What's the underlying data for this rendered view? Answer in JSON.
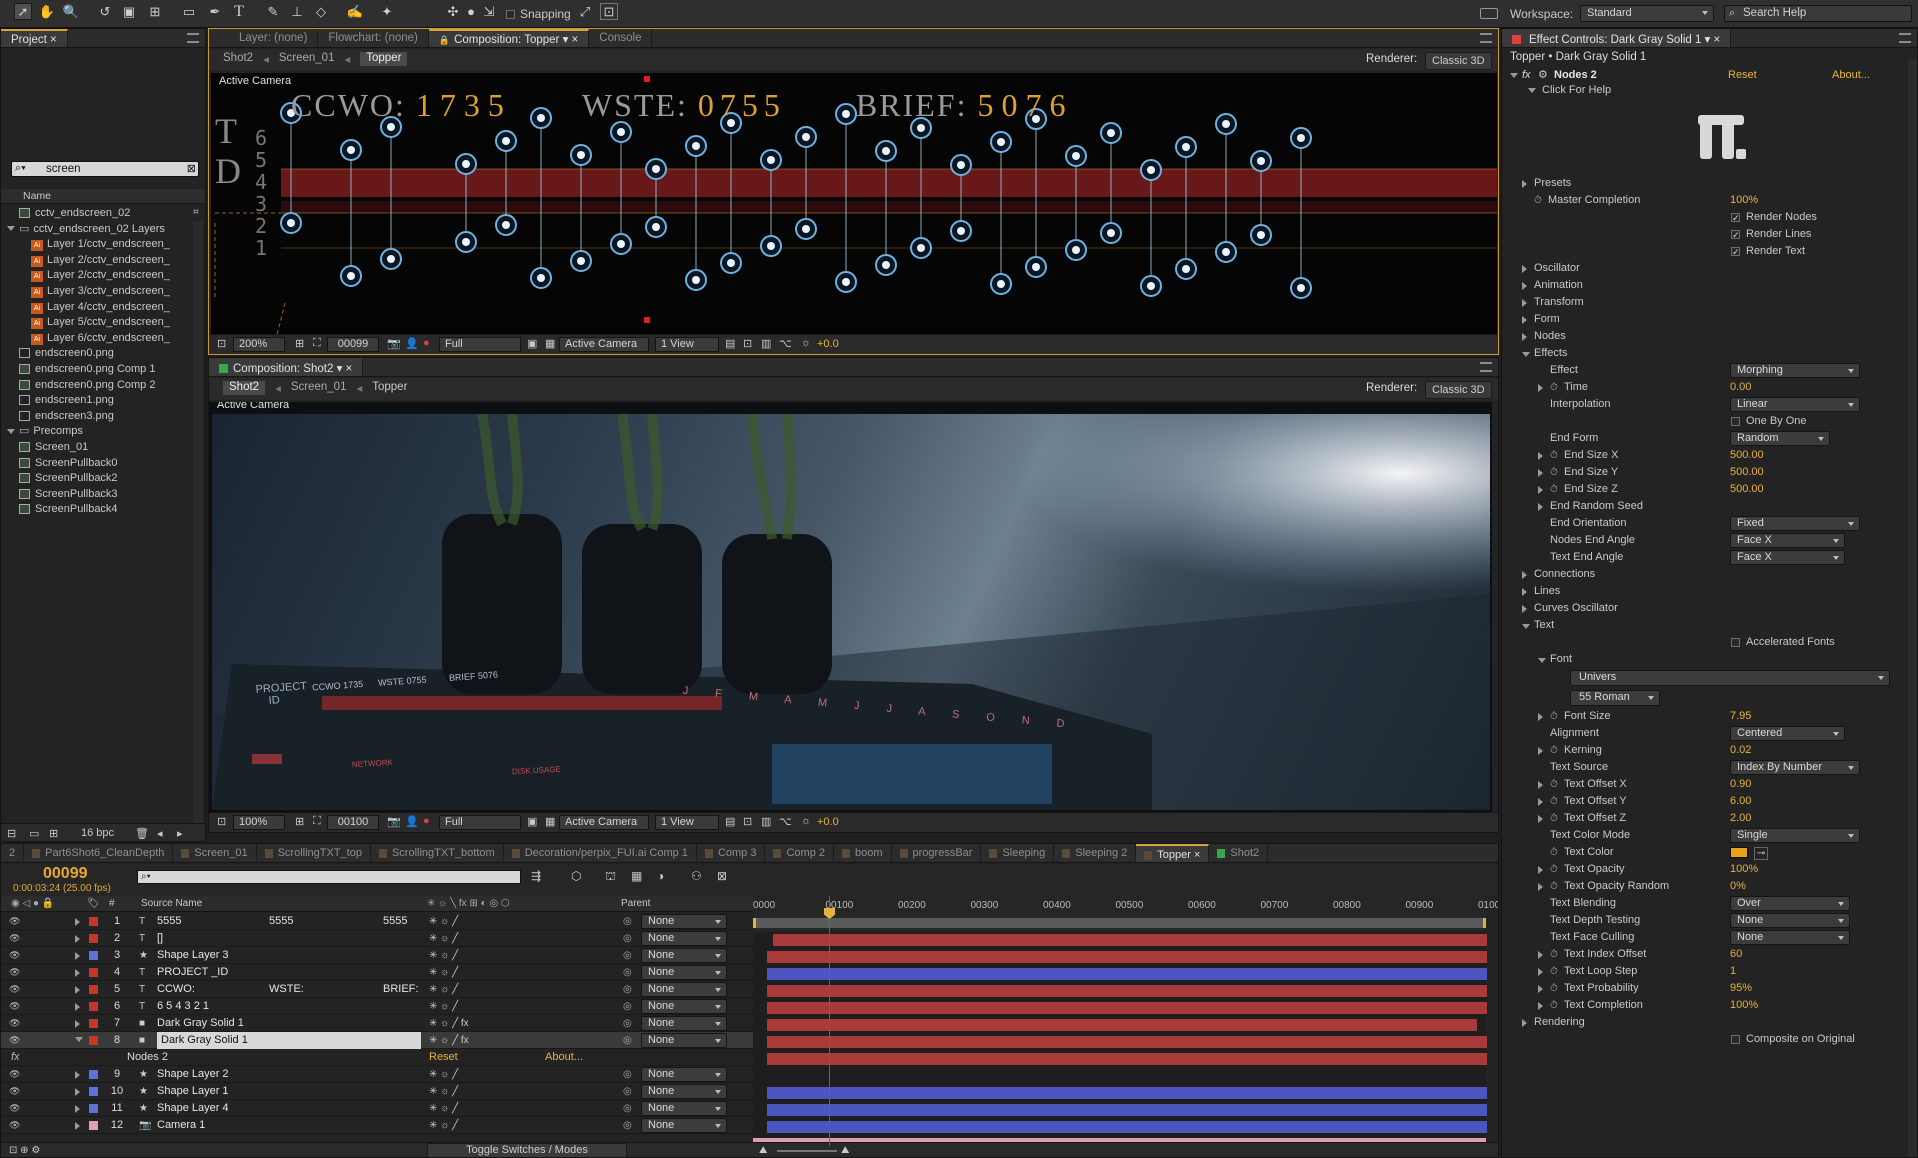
{
  "toolbar": {
    "snapping_label": "Snapping",
    "workspace_label": "Workspace:",
    "workspace_value": "Standard",
    "search_help_placeholder": "Search Help"
  },
  "project_panel": {
    "tab": "Project",
    "search_value": "screen",
    "column_name": "Name",
    "items": [
      {
        "label": "cctv_endscreen_02",
        "type": "comp",
        "indent": 0
      },
      {
        "label": "cctv_endscreen_02 Layers",
        "type": "folder",
        "indent": 0,
        "open": true
      },
      {
        "label": "Layer 1/cctv_endscreen_",
        "type": "ai",
        "indent": 1
      },
      {
        "label": "Layer 2/cctv_endscreen_",
        "type": "ai",
        "indent": 1
      },
      {
        "label": "Layer 2/cctv_endscreen_",
        "type": "ai",
        "indent": 1
      },
      {
        "label": "Layer 3/cctv_endscreen_",
        "type": "ai",
        "indent": 1
      },
      {
        "label": "Layer 4/cctv_endscreen_",
        "type": "ai",
        "indent": 1
      },
      {
        "label": "Layer 5/cctv_endscreen_",
        "type": "ai",
        "indent": 1
      },
      {
        "label": "Layer 6/cctv_endscreen_",
        "type": "ai",
        "indent": 1
      },
      {
        "label": "endscreen0.png",
        "type": "img",
        "indent": 0
      },
      {
        "label": "endscreen0.png Comp 1",
        "type": "comp",
        "indent": 0
      },
      {
        "label": "endscreen0.png Comp 2",
        "type": "comp",
        "indent": 0
      },
      {
        "label": "endscreen1.png",
        "type": "img",
        "indent": 0
      },
      {
        "label": "endscreen3.png",
        "type": "img",
        "indent": 0
      },
      {
        "label": "Precomps",
        "type": "folder",
        "indent": 0,
        "open": true
      },
      {
        "label": "Screen_01",
        "type": "comp",
        "indent": 1
      },
      {
        "label": "ScreenPullback0",
        "type": "comp",
        "indent": 0
      },
      {
        "label": "ScreenPullback2",
        "type": "comp",
        "indent": 0
      },
      {
        "label": "ScreenPullback3",
        "type": "comp",
        "indent": 0
      },
      {
        "label": "ScreenPullback4",
        "type": "comp",
        "indent": 0
      }
    ],
    "bpc": "16 bpc"
  },
  "viewer_top": {
    "tabs": [
      "Layer: (none)",
      "Flowchart: (none)",
      "Composition: Topper",
      "Console"
    ],
    "breadcrumbs": [
      "Shot2",
      "Screen_01",
      "Topper"
    ],
    "renderer_label": "Renderer:",
    "renderer_value": "Classic 3D",
    "camera_label": "Active Camera",
    "hud": {
      "ccwo_label": "CCWO:",
      "ccwo_value": "1735",
      "wste_label": "WSTE:",
      "wste_value": "0755",
      "brief_label": "BRIEF:",
      "brief_value": "5076"
    },
    "zoom": "200%",
    "frame": "00099",
    "resolution": "Full",
    "view_camera": "Active Camera",
    "views": "1 View",
    "exposure": "+0.0"
  },
  "viewer_bottom": {
    "tab": "Composition: Shot2",
    "breadcrumbs": [
      "Shot2",
      "Screen_01",
      "Topper"
    ],
    "renderer_label": "Renderer:",
    "renderer_value": "Classic 3D",
    "camera_label": "Active Camera",
    "zoom": "100%",
    "frame": "00100",
    "resolution": "Full",
    "view_camera": "Active Camera",
    "views": "1 View",
    "exposure": "+0.0",
    "scene_text": {
      "project": "PROJECT",
      "id": "ID",
      "ccwo": "CCWO 1735",
      "wste": "WSTE 0755",
      "brief": "BRIEF 5076",
      "network": "NETWORK",
      "disk": "DISK USAGE",
      "months": "J F M A M J J A S O N D"
    }
  },
  "timeline": {
    "tabs": [
      "2",
      "Part6Shot6_CleanDepth",
      "Screen_01",
      "ScrollingTXT_top",
      "ScrollingTXT_bottom",
      "Decoration/perpix_FUI.ai Comp 1",
      "Comp 3",
      "Comp 2",
      "boom",
      "progressBar",
      "Sleeping",
      "Sleeping 2",
      "Topper",
      "Shot2"
    ],
    "active_tab": "Topper",
    "timecode": "00099",
    "timecode_sub": "0:00:03:24 (25.00 fps)",
    "col_source": "Source Name",
    "col_parent": "Parent",
    "ruler": [
      "0000",
      "00100",
      "00200",
      "00300",
      "00400",
      "00500",
      "00600",
      "00700",
      "00800",
      "00900",
      "0100"
    ],
    "layers": [
      {
        "num": "1",
        "name": "5555",
        "extra1": "5555",
        "extra2": "5555",
        "type": "T",
        "color": "#c0392b",
        "parent": "None",
        "bar": "red"
      },
      {
        "num": "2",
        "name": "[]",
        "type": "T",
        "color": "#c0392b",
        "parent": "None",
        "bar": "red"
      },
      {
        "num": "3",
        "name": "Shape Layer 3",
        "type": "★",
        "color": "#5b72d6",
        "parent": "None",
        "bar": "blue"
      },
      {
        "num": "4",
        "name": "PROJECT _ID",
        "type": "T",
        "color": "#c0392b",
        "parent": "None",
        "bar": "red"
      },
      {
        "num": "5",
        "name": "CCWO:",
        "extra1": "WSTE:",
        "extra2": "BRIEF:",
        "type": "T",
        "color": "#c0392b",
        "parent": "None",
        "bar": "red"
      },
      {
        "num": "6",
        "name": "6 5 4 3 2 1",
        "type": "T",
        "color": "#c0392b",
        "parent": "None",
        "bar": "red"
      },
      {
        "num": "7",
        "name": "Dark Gray Solid 1",
        "type": "■",
        "color": "#c0392b",
        "parent": "None",
        "bar": "red",
        "fx": true
      },
      {
        "num": "8",
        "name": "Dark Gray Solid 1",
        "type": "■",
        "color": "#c0392b",
        "parent": "None",
        "bar": "red",
        "fx": true,
        "selected": true
      },
      {
        "num": "9",
        "name": "Shape Layer 2",
        "type": "★",
        "color": "#5b72d6",
        "parent": "None",
        "bar": "blue"
      },
      {
        "num": "10",
        "name": "Shape Layer 1",
        "type": "★",
        "color": "#5b72d6",
        "parent": "None",
        "bar": "blue"
      },
      {
        "num": "11",
        "name": "Shape Layer 4",
        "type": "★",
        "color": "#5b72d6",
        "parent": "None",
        "bar": "blue"
      },
      {
        "num": "12",
        "name": "Camera 1",
        "type": "📷",
        "color": "#e0a0b0",
        "parent": "None",
        "bar": "pink"
      }
    ],
    "fx_row": {
      "name": "Nodes 2",
      "reset": "Reset",
      "about": "About..."
    },
    "toggle_label": "Toggle Switches / Modes"
  },
  "effect_controls": {
    "tab": "Effect Controls: Dark Gray Solid 1",
    "subtitle": "Topper • Dark Gray Solid 1",
    "effect_name": "Nodes 2",
    "reset": "Reset",
    "about": "About...",
    "click_help": "Click For Help",
    "rows": [
      {
        "t": "group",
        "label": "Presets",
        "indent": 1
      },
      {
        "t": "val",
        "label": "Master Completion",
        "value": "100%",
        "indent": 1,
        "stop": true
      },
      {
        "t": "check",
        "label": "Render Nodes",
        "checked": true
      },
      {
        "t": "check",
        "label": "Render Lines",
        "checked": true
      },
      {
        "t": "check",
        "label": "Render Text",
        "checked": true
      },
      {
        "t": "gap"
      },
      {
        "t": "group",
        "label": "Oscillator",
        "indent": 1
      },
      {
        "t": "group",
        "label": "Animation",
        "indent": 1
      },
      {
        "t": "group",
        "label": "Transform",
        "indent": 1
      },
      {
        "t": "group",
        "label": "Form",
        "indent": 1
      },
      {
        "t": "group",
        "label": "Nodes",
        "indent": 1
      },
      {
        "t": "groupopen",
        "label": "Effects",
        "indent": 1
      },
      {
        "t": "drop",
        "label": "Effect",
        "value": "Morphing",
        "indent": 2,
        "w": 130
      },
      {
        "t": "val",
        "label": "Time",
        "value": "0.00",
        "indent": 2,
        "stop": true,
        "tri": true
      },
      {
        "t": "drop",
        "label": "Interpolation",
        "value": "Linear",
        "indent": 2,
        "w": 130
      },
      {
        "t": "check",
        "label": "One By One",
        "checked": false
      },
      {
        "t": "drop",
        "label": "End Form",
        "value": "Random",
        "indent": 2,
        "w": 100
      },
      {
        "t": "val",
        "label": "End Size X",
        "value": "500.00",
        "indent": 2,
        "stop": true,
        "tri": true
      },
      {
        "t": "val",
        "label": "End Size Y",
        "value": "500.00",
        "indent": 2,
        "stop": true,
        "tri": true
      },
      {
        "t": "val",
        "label": "End Size Z",
        "value": "500.00",
        "indent": 2,
        "stop": true,
        "tri": true
      },
      {
        "t": "group",
        "label": "End Random Seed",
        "indent": 2
      },
      {
        "t": "drop",
        "label": "End Orientation",
        "value": "Fixed",
        "indent": 2,
        "w": 130
      },
      {
        "t": "drop",
        "label": "Nodes End Angle",
        "value": "Face  X",
        "indent": 2,
        "w": 115
      },
      {
        "t": "drop",
        "label": "Text End Angle",
        "value": "Face  X",
        "indent": 2,
        "w": 115
      },
      {
        "t": "group",
        "label": "Connections",
        "indent": 1
      },
      {
        "t": "group",
        "label": "Lines",
        "indent": 1
      },
      {
        "t": "group",
        "label": "Curves Oscillator",
        "indent": 1
      },
      {
        "t": "groupopen",
        "label": "Text",
        "indent": 1
      },
      {
        "t": "check",
        "label": "Accelerated Fonts",
        "checked": false
      },
      {
        "t": "groupopen",
        "label": "Font",
        "indent": 2
      },
      {
        "t": "fontdrop",
        "value": "Univers"
      },
      {
        "t": "fontstyle",
        "value": "55 Roman"
      },
      {
        "t": "val",
        "label": "Font Size",
        "value": "7.95",
        "indent": 2,
        "stop": true,
        "tri": true
      },
      {
        "t": "drop",
        "label": "Alignment",
        "value": "Centered",
        "indent": 2,
        "w": 115
      },
      {
        "t": "val",
        "label": "Kerning",
        "value": "0.02",
        "indent": 2,
        "stop": true,
        "tri": true
      },
      {
        "t": "drop",
        "label": "Text Source",
        "value": "Index By Number",
        "indent": 2,
        "w": 130
      },
      {
        "t": "val",
        "label": "Text Offset X",
        "value": "0.90",
        "indent": 2,
        "stop": true,
        "tri": true
      },
      {
        "t": "val",
        "label": "Text Offset Y",
        "value": "6.00",
        "indent": 2,
        "stop": true,
        "tri": true
      },
      {
        "t": "val",
        "label": "Text Offset Z",
        "value": "2.00",
        "indent": 2,
        "stop": true,
        "tri": true
      },
      {
        "t": "drop",
        "label": "Text Color Mode",
        "value": "Single",
        "indent": 2,
        "w": 130
      },
      {
        "t": "color",
        "label": "Text Color",
        "value": "#e8a417",
        "indent": 2
      },
      {
        "t": "val",
        "label": "Text Opacity",
        "value": "100%",
        "indent": 2,
        "stop": true,
        "tri": true
      },
      {
        "t": "val",
        "label": "Text Opacity Random",
        "value": "0%",
        "indent": 2,
        "stop": true,
        "tri": true
      },
      {
        "t": "drop",
        "label": "Text Blending",
        "value": "Over",
        "indent": 2,
        "w": 120
      },
      {
        "t": "drop",
        "label": "Text Depth Testing",
        "value": "None",
        "indent": 2,
        "w": 120
      },
      {
        "t": "drop",
        "label": "Text Face Culling",
        "value": "None",
        "indent": 2,
        "w": 120
      },
      {
        "t": "val",
        "label": "Text Index Offset",
        "value": "60",
        "indent": 2,
        "stop": true,
        "tri": true
      },
      {
        "t": "val",
        "label": "Text Loop Step",
        "value": "1",
        "indent": 2,
        "stop": true,
        "tri": true
      },
      {
        "t": "val",
        "label": "Text Probability",
        "value": "95%",
        "indent": 2,
        "stop": true,
        "tri": true
      },
      {
        "t": "val",
        "label": "Text Completion",
        "value": "100%",
        "indent": 2,
        "stop": true,
        "tri": true
      },
      {
        "t": "group",
        "label": "Rendering",
        "indent": 1
      },
      {
        "t": "check",
        "label": "Composite on Original",
        "checked": false
      }
    ]
  }
}
